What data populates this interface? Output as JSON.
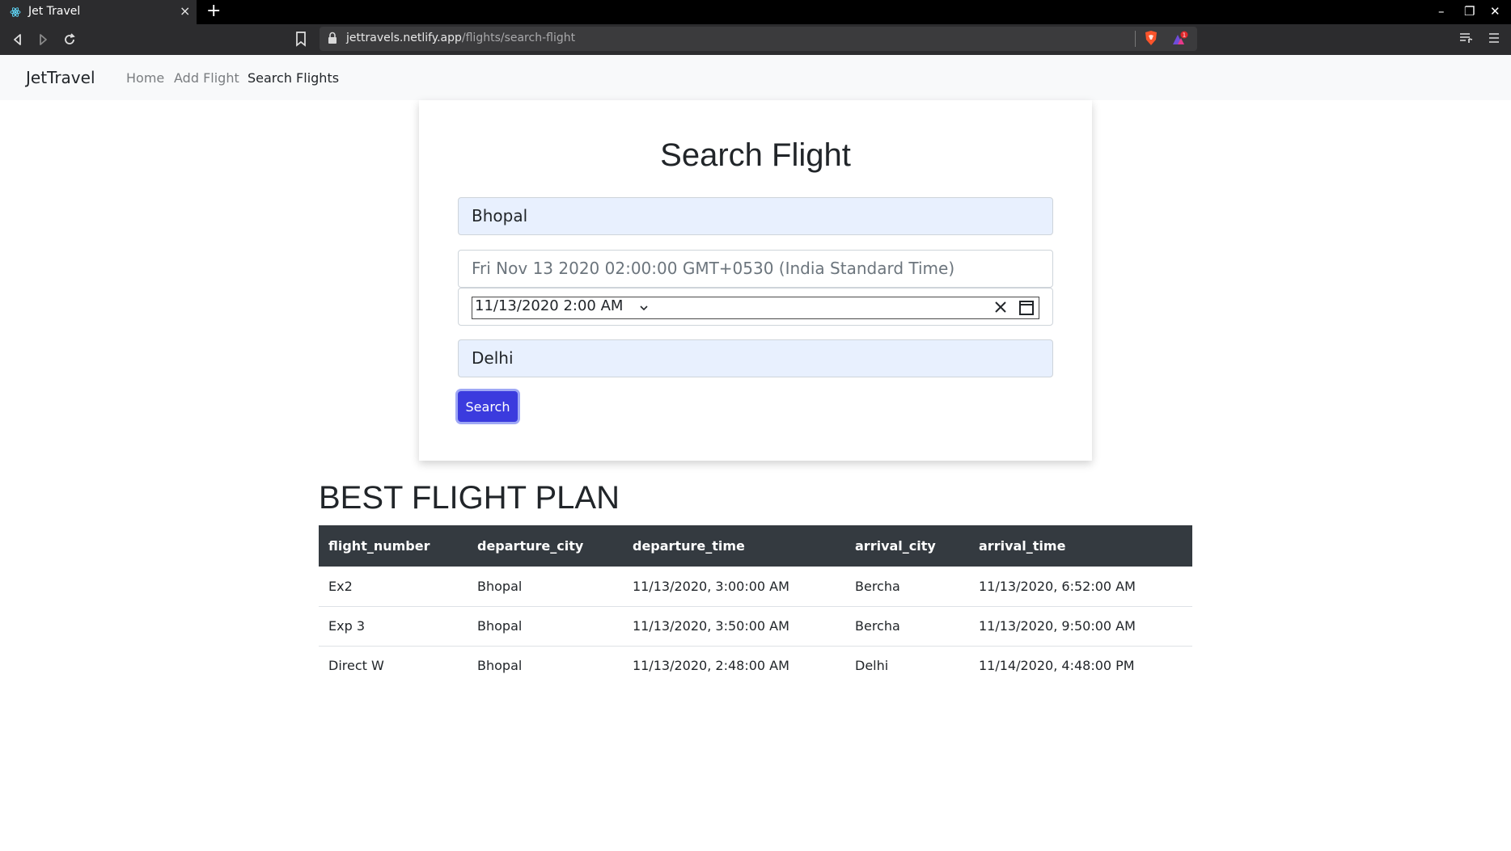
{
  "browser": {
    "tab_title": "Jet Travel",
    "tab_close_label": "×",
    "new_tab_label": "+",
    "url_host": "jettravels.netlify.app",
    "url_path": "/flights/search-flight",
    "rewards_badge": "1",
    "window_controls": {
      "minimize": "–",
      "restore": "❐",
      "close": "✕"
    }
  },
  "navbar": {
    "brand": "JetTravel",
    "links": [
      {
        "label": "Home",
        "active": false
      },
      {
        "label": "Add Flight",
        "active": false
      },
      {
        "label": "Search Flights",
        "active": true
      }
    ]
  },
  "search_form": {
    "title": "Search Flight",
    "departure_city": "Bhopal",
    "date_display": "Fri Nov 13 2020 02:00:00 GMT+0530 (India Standard Time)",
    "datetime_value": "11/13/2020 2:00 AM",
    "arrival_city": "Delhi",
    "search_button": "Search",
    "button_color": "#3b3bde"
  },
  "results": {
    "title": "BEST FLIGHT PLAN",
    "columns": [
      "flight_number",
      "departure_city",
      "departure_time",
      "arrival_city",
      "arrival_time"
    ],
    "rows": [
      [
        "Ex2",
        "Bhopal",
        "11/13/2020, 3:00:00 AM",
        "Bercha",
        "11/13/2020, 6:52:00 AM"
      ],
      [
        "Exp 3",
        "Bhopal",
        "11/13/2020, 3:50:00 AM",
        "Bercha",
        "11/13/2020, 9:50:00 AM"
      ],
      [
        "Direct W",
        "Bhopal",
        "11/13/2020, 2:48:00 AM",
        "Delhi",
        "11/14/2020, 4:48:00 PM"
      ]
    ],
    "header_color": "#343a40"
  }
}
